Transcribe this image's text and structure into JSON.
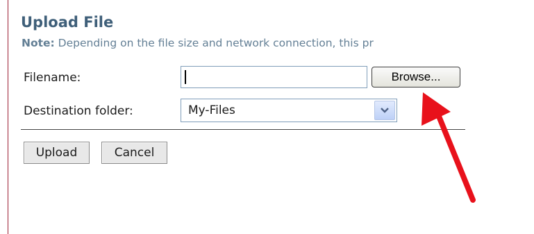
{
  "upload": {
    "title": "Upload File",
    "note_label": "Note:",
    "note_text": " Depending on the file size and network connection, this pr",
    "filename_label": "Filename:",
    "filename_value": "",
    "browse_label": "Browse...",
    "destination_label": "Destination folder:",
    "destination_value": "My-Files",
    "upload_label": "Upload",
    "cancel_label": "Cancel"
  },
  "colors": {
    "heading": "#3f5f79",
    "note": "#637f95",
    "annotation_arrow": "#e8111b",
    "left_rule": "#9b1b30"
  },
  "icons": {
    "select_arrow": "chevron-down-icon",
    "annotation": "red-arrow-icon"
  }
}
